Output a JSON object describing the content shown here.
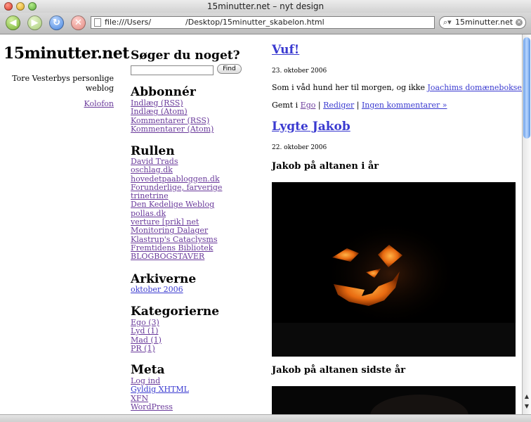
{
  "window": {
    "title": "15minutter.net – nyt design"
  },
  "toolbar": {
    "back_icon": "back-arrow",
    "forward_icon": "forward-arrow",
    "reload_icon": "reload-arrow",
    "stop_icon": "stop-x",
    "address": "file:///Users/              /Desktop/15minutter_skabelon.html",
    "search_value": "15minutter.net"
  },
  "header": {
    "title": "15minutter.net",
    "tagline": "Tore Vesterbys personlige weblog",
    "colophon": "Kolofon"
  },
  "sidebar": {
    "search_heading": "Søger du noget?",
    "search_value": "",
    "find_label": "Find",
    "subscribe": {
      "heading": "Abbonnér",
      "items": [
        "Indlæg (RSS)",
        "Indlæg (Atom)",
        "Kommentarer (RSS)",
        "Kommentarer (Atom)"
      ]
    },
    "roll": {
      "heading": "Rullen",
      "items": [
        "David Trads",
        "oschlag.dk",
        "hovedetpaabloggen.dk",
        "Forunderlige, farverige",
        "trinetrine",
        "Den Kedelige Weblog",
        "pollas.dk",
        "verture [prik] net",
        "Monitoring Dalager",
        "Klastrup's Cataclysms",
        "Fremtidens Bibliotek",
        "BLOGBOGSTAVER"
      ]
    },
    "archive": {
      "heading": "Arkiverne",
      "items": [
        "oktober 2006"
      ]
    },
    "categories": {
      "heading": "Kategorierne",
      "items": [
        "Ego (3)",
        "Lyd (1)",
        "Mad (1)",
        "PR (1)"
      ]
    },
    "meta": {
      "heading": "Meta",
      "items": [
        "Log ind",
        "Gyldig XHTML",
        "XFN",
        "WordPress"
      ]
    }
  },
  "posts": [
    {
      "title": "Vuf!",
      "date": "23. oktober 2006",
      "body_pre": "Som i våd hund her til morgen, og ikke ",
      "body_link": "Joachims domæneboksekamp",
      "body_post": ".",
      "meta_prefix": "Gemt i ",
      "category": "Ego",
      "sep": " | ",
      "edit": "Rediger",
      "comments": "Ingen kommentarer »"
    },
    {
      "title": "Lygte Jakob",
      "date": "22. oktober 2006",
      "caption1": "Jakob på altanen i år",
      "caption2": "Jakob på altanen sidste år"
    }
  ],
  "colors": {
    "link": "#3a3ad0",
    "visited_link": "#6a3a9b",
    "scroll_thumb": "#6aa0e8"
  }
}
